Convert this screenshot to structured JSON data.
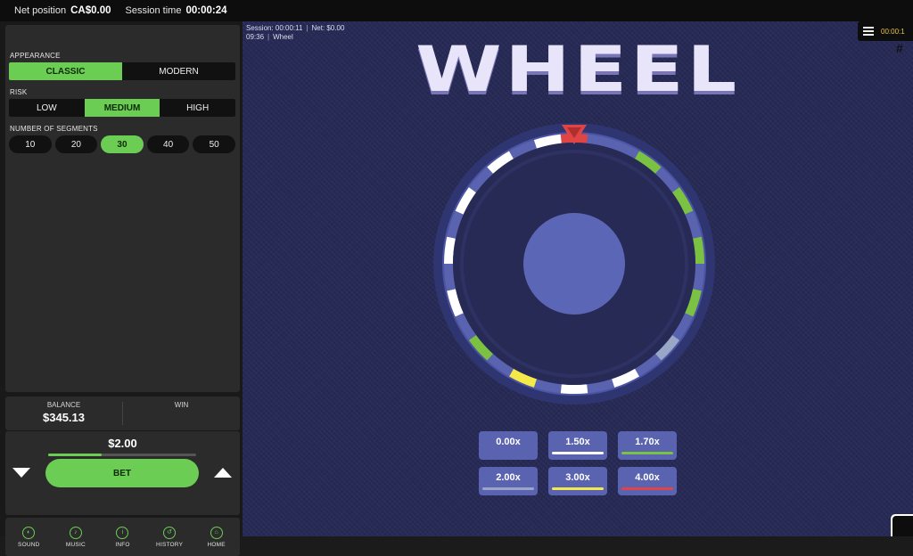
{
  "topbar": {
    "net_position_label": "Net position",
    "net_position_value": "CA$0.00",
    "session_time_label": "Session time",
    "session_time_value": "00:00:24"
  },
  "settings": {
    "appearance": {
      "label": "APPEARANCE",
      "options": [
        "CLASSIC",
        "MODERN"
      ],
      "selected": "CLASSIC"
    },
    "risk": {
      "label": "RISK",
      "options": [
        "LOW",
        "MEDIUM",
        "HIGH"
      ],
      "selected": "MEDIUM"
    },
    "segments": {
      "label": "NUMBER OF SEGMENTS",
      "options": [
        "10",
        "20",
        "30",
        "40",
        "50"
      ],
      "selected": "30"
    }
  },
  "balance": {
    "balance_label": "BALANCE",
    "balance_value": "$345.13",
    "win_label": "WIN",
    "win_value": ""
  },
  "bet": {
    "amount": "$2.00",
    "button_label": "BET",
    "slider_fraction": 0.36
  },
  "nav": [
    {
      "label": "SOUND",
      "icon": "sound-icon",
      "glyph": "◐"
    },
    {
      "label": "MUSIC",
      "icon": "music-icon",
      "glyph": "♪"
    },
    {
      "label": "INFO",
      "icon": "info-icon",
      "glyph": "i"
    },
    {
      "label": "HISTORY",
      "icon": "history-icon",
      "glyph": "↺"
    },
    {
      "label": "HOME",
      "icon": "home-icon",
      "glyph": "⌂"
    }
  ],
  "game": {
    "session_line": "Session: 00:00:11",
    "net_line": "Net:  $0.00",
    "clock_line": "09:36",
    "game_name": "Wheel",
    "title": "WHEEL",
    "hud_clock": "00:00:1"
  },
  "wheel": {
    "segment_count": 30,
    "segments": [
      "red",
      "blue",
      "blue",
      "green",
      "blue",
      "green",
      "blue",
      "green",
      "blue",
      "green",
      "blue",
      "grey",
      "blue",
      "white",
      "blue",
      "white",
      "blue",
      "yellow",
      "blue",
      "green",
      "blue",
      "white",
      "blue",
      "white",
      "blue",
      "white",
      "blue",
      "white",
      "blue",
      "white"
    ]
  },
  "multipliers": [
    {
      "value": "0.00x",
      "color": "#5a63b0"
    },
    {
      "value": "1.50x",
      "color": "#ffffff"
    },
    {
      "value": "1.70x",
      "color": "#7cc242"
    },
    {
      "value": "2.00x",
      "color": "#9aa6c6"
    },
    {
      "value": "3.00x",
      "color": "#f5e94a"
    },
    {
      "value": "4.00x",
      "color": "#e04545"
    }
  ],
  "colors": {
    "accent_green": "#6ccd55",
    "background": "#262a55",
    "segment_blue": "#5a63b0",
    "segment_white": "#ffffff",
    "segment_green": "#7cc242",
    "segment_grey": "#9aa6c6",
    "segment_yellow": "#f5e94a",
    "segment_red": "#e04545"
  }
}
